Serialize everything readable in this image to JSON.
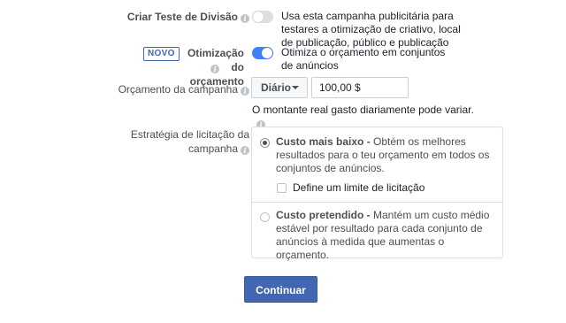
{
  "split_test": {
    "label": "Criar Teste de Divisão",
    "description": "Usa esta campanha publicitária para testares a otimização de criativo, local de publicação, público e publicação",
    "toggle_on": false
  },
  "budget_optimization": {
    "badge": "NOVO",
    "label": "Otimização do orçamento",
    "description": "Otimiza o orçamento em conjuntos de anúncios",
    "toggle_on": true
  },
  "campaign_budget": {
    "label": "Orçamento da campanha",
    "period_selected": "Diário",
    "amount": "100,00 $",
    "note": "O montante real gasto diariamente pode variar."
  },
  "bid_strategy": {
    "label": "Estratégia de licitação da campanha",
    "options": [
      {
        "title": "Custo mais baixo",
        "text": "Obtém os melhores resultados para o teu orçamento em todos os conjuntos de anúncios.",
        "selected": true
      },
      {
        "title": "Custo pretendido",
        "text": "Mantém um custo médio estável por resultado para cada conjunto de anúncios à medida que aumentas o orçamento.",
        "selected": false
      }
    ],
    "bid_limit_label": "Define um limite de licitação",
    "separator": " - "
  },
  "continue_button": "Continuar",
  "colors": {
    "accent": "#4267b2",
    "toggle_on": "#4080ff",
    "text": "#4b4f56"
  }
}
